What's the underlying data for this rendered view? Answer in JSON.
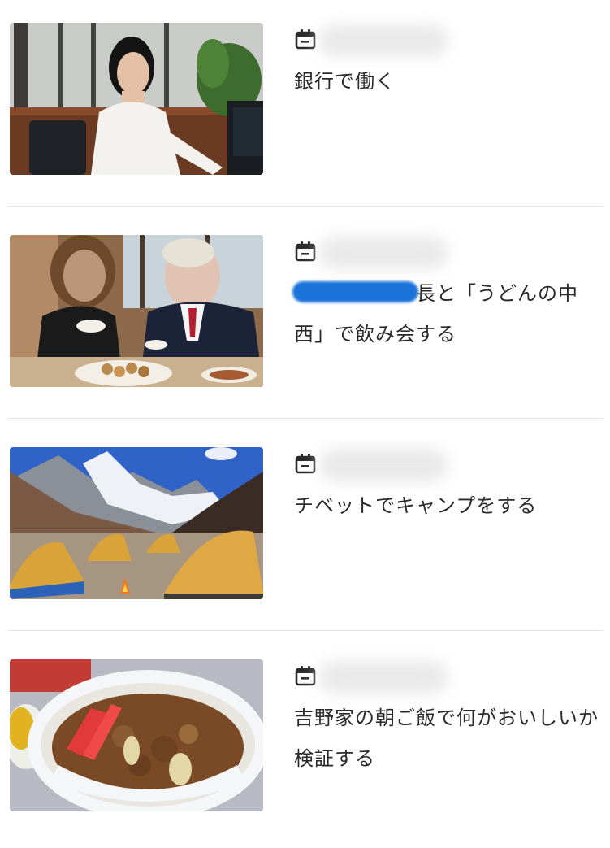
{
  "entries": [
    {
      "title": "銀行で働く",
      "image_alt": "bank-office-worker-photo"
    },
    {
      "title_line": "と「うどんの中西」で飲み会する",
      "title_leading": "長",
      "image_alt": "restaurant-dinner-photo"
    },
    {
      "title": "チベットでキャンプをする",
      "image_alt": "tibet-camping-photo"
    },
    {
      "title": "吉野家の朝ご飯で何がおいしいか検証する",
      "image_alt": "gyudon-bowl-photo"
    }
  ],
  "icons": {
    "calendar": "calendar-icon"
  },
  "colors": {
    "redaction_blue": "#1a73d9",
    "divider": "#e3e3e3",
    "icon_dark": "#2b2b2b"
  }
}
